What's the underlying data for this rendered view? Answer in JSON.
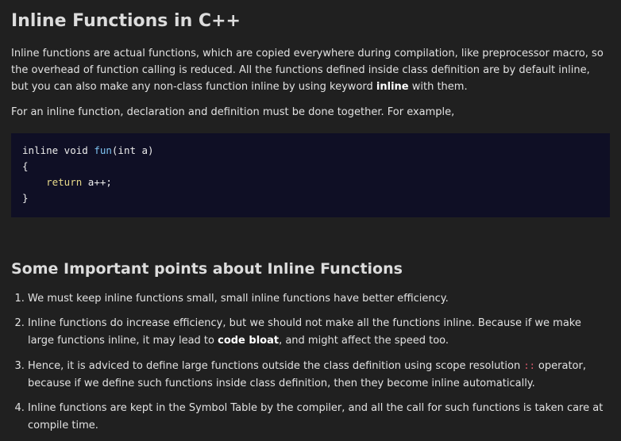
{
  "title": "Inline Functions in C++",
  "intro": {
    "part1": "Inline functions are actual functions, which are copied everywhere during compilation, like preprocessor macro, so the overhead of function calling is reduced. All the functions defined inside class definition are by default inline, but you can also make any non-class function inline by using keyword ",
    "keyword": "inline",
    "part2": " with them."
  },
  "example_intro": "For an inline function, declaration and definition must be done together. For example,",
  "code": {
    "l1_pre": "inline void ",
    "l1_fn": "fun",
    "l1_post": "(int a)",
    "l2": "{",
    "l3_indent": "    ",
    "l3_kw": "return",
    "l3_post": " a++;",
    "l4": "}"
  },
  "section_title": "Some Important points about Inline Functions",
  "points": {
    "p1": "We must keep inline functions small, small inline functions have better efficiency.",
    "p2_a": "Inline functions do increase efficiency, but we should not make all the functions inline. Because if we make large functions inline, it may lead to ",
    "p2_bold": "code bloat",
    "p2_b": ", and might affect the speed too.",
    "p3_a": "Hence, it is adviced to define large functions outside the class definition using scope resolution ",
    "p3_op": "::",
    "p3_b": " operator, because if we define such functions inside class definition, then they become inline automatically.",
    "p4": "Inline functions are kept in the Symbol Table by the compiler, and all the call for such functions is taken care at compile time."
  }
}
